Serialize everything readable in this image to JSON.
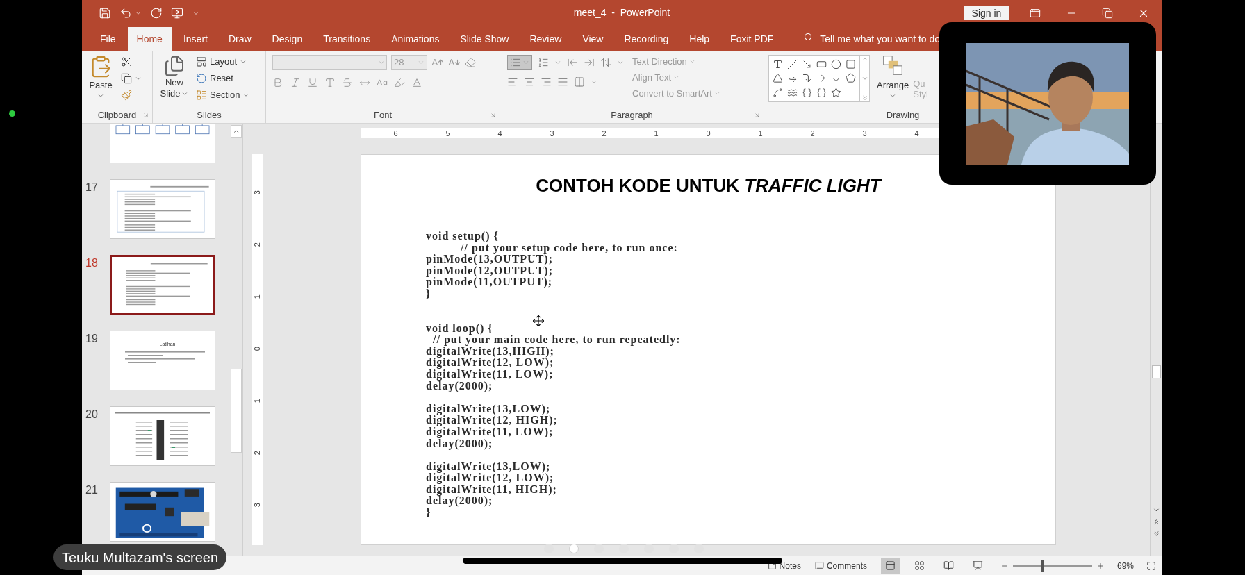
{
  "title_bar": {
    "title": "meet_4  -  PowerPoint",
    "sign_in": "Sign in"
  },
  "tabs": [
    {
      "label": "File",
      "selected": false
    },
    {
      "label": "Home",
      "selected": true
    },
    {
      "label": "Insert",
      "selected": false
    },
    {
      "label": "Draw",
      "selected": false
    },
    {
      "label": "Design",
      "selected": false
    },
    {
      "label": "Transitions",
      "selected": false
    },
    {
      "label": "Animations",
      "selected": false
    },
    {
      "label": "Slide Show",
      "selected": false
    },
    {
      "label": "Review",
      "selected": false
    },
    {
      "label": "View",
      "selected": false
    },
    {
      "label": "Recording",
      "selected": false
    },
    {
      "label": "Help",
      "selected": false
    },
    {
      "label": "Foxit PDF",
      "selected": false
    }
  ],
  "tell_me": "Tell me what you want to do",
  "clipboard": {
    "paste": "Paste",
    "label": "Clipboard"
  },
  "slides_group": {
    "new_slide": [
      "New",
      "Slide"
    ],
    "layout": "Layout",
    "reset": "Reset",
    "section": "Section",
    "label": "Slides"
  },
  "font_group": {
    "size": "28",
    "label": "Font"
  },
  "paragraph_group": {
    "bullets_on": true,
    "text_direction": "Text Direction",
    "align_text": "Align Text",
    "convert": "Convert to SmartArt",
    "label": "Paragraph"
  },
  "drawing_group": {
    "arrange": "Arrange",
    "quick_styles": [
      "Qu",
      "Styl"
    ],
    "label": "Drawing"
  },
  "thumbnails": [
    {
      "kind": "orgchart",
      "selected": false
    },
    {
      "number": "17",
      "kind": "code",
      "selected": false
    },
    {
      "number": "18",
      "kind": "code",
      "selected": true
    },
    {
      "number": "19",
      "kind": "text",
      "title": "Latihan",
      "selected": false
    },
    {
      "number": "20",
      "kind": "diagram",
      "selected": false
    },
    {
      "number": "21",
      "kind": "picture",
      "selected": false
    }
  ],
  "rulers": {
    "horizontal": [
      "6",
      "5",
      "4",
      "3",
      "2",
      "1",
      "0",
      "1",
      "2",
      "3",
      "4"
    ],
    "vertical": [
      "3",
      "2",
      "1",
      "0",
      "1",
      "2",
      "3"
    ]
  },
  "slide": {
    "title": "CONTOH KODE UNTUK *TRAFFIC LIGHT*",
    "code_blocks": [
      [
        "void setup() {",
        "          // put your setup code here, to run once:",
        "pinMode(13,OUTPUT);",
        "pinMode(12,OUTPUT);",
        "pinMode(11,OUTPUT);",
        "}"
      ],
      [
        "void loop() {",
        "  // put your main code here, to run repeatedly:",
        "digitalWrite(13,HIGH);",
        "digitalWrite(12, LOW);",
        "digitalWrite(11, LOW);",
        "delay(2000);"
      ],
      [
        "digitalWrite(13,LOW);",
        "digitalWrite(12, HIGH);",
        "digitalWrite(11, LOW);",
        "delay(2000);"
      ],
      [
        "digitalWrite(13,LOW);",
        "digitalWrite(12, LOW);",
        "digitalWrite(11, HIGH);",
        "delay(2000);",
        "}"
      ]
    ]
  },
  "pager": [
    {
      "selected": false
    },
    {
      "selected": true
    },
    {
      "selected": false
    },
    {
      "selected": false
    },
    {
      "selected": false
    },
    {
      "selected": false
    },
    {
      "selected": false
    }
  ],
  "status_bar": {
    "notes": "Notes",
    "comments": "Comments",
    "views": [
      {
        "kind": "normal",
        "selected": true
      },
      {
        "kind": "sorter",
        "selected": false
      },
      {
        "kind": "reading",
        "selected": false
      },
      {
        "kind": "slideshow",
        "selected": false
      }
    ],
    "zoom": {
      "level": 0.37,
      "reading": "69%"
    }
  },
  "share_label": "Teuku Multazam's screen"
}
